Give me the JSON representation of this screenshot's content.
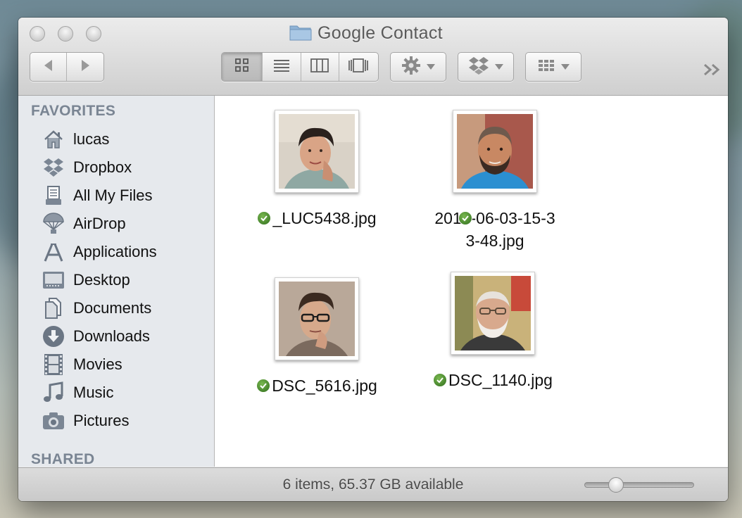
{
  "window": {
    "title": "Google Contact",
    "title_icon": "folder-icon"
  },
  "toolbar": {
    "back_icon": "chevron-left-icon",
    "forward_icon": "chevron-right-icon",
    "view_modes": [
      {
        "name": "icon-view",
        "icon": "grid-icon",
        "active": true
      },
      {
        "name": "list-view",
        "icon": "list-icon",
        "active": false
      },
      {
        "name": "column-view",
        "icon": "columns-icon",
        "active": false
      },
      {
        "name": "cover-flow-view",
        "icon": "coverflow-icon",
        "active": false
      }
    ],
    "action_icon": "gear-icon",
    "dropbox_icon": "dropbox-icon",
    "arrange_icon": "arrange-grid-icon",
    "overflow_icon": "double-chevron-right-icon"
  },
  "sidebar": {
    "favorites_heading": "FAVORITES",
    "items": [
      {
        "label": "lucas",
        "icon": "home-icon"
      },
      {
        "label": "Dropbox",
        "icon": "dropbox-icon"
      },
      {
        "label": "All My Files",
        "icon": "all-files-icon"
      },
      {
        "label": "AirDrop",
        "icon": "airdrop-icon"
      },
      {
        "label": "Applications",
        "icon": "applications-icon"
      },
      {
        "label": "Desktop",
        "icon": "desktop-icon"
      },
      {
        "label": "Documents",
        "icon": "documents-icon"
      },
      {
        "label": "Downloads",
        "icon": "downloads-icon"
      },
      {
        "label": "Movies",
        "icon": "movies-icon"
      },
      {
        "label": "Music",
        "icon": "music-icon"
      },
      {
        "label": "Pictures",
        "icon": "pictures-icon"
      }
    ],
    "shared_heading": "SHARED"
  },
  "files": [
    {
      "name": "_LUC5438.jpg",
      "synced": true
    },
    {
      "name": "2012-06-03-15-33-48.jpg",
      "name_lines": [
        "2012-06-03-15-3",
        "3-48.jpg"
      ],
      "synced": true
    },
    {
      "name": "DSC_5616.jpg",
      "synced": true
    },
    {
      "name": "DSC_1140.jpg",
      "synced": true
    }
  ],
  "status": {
    "text": "6 items, 65.37 GB available",
    "icon_size_level": 0.25
  },
  "colors": {
    "sidebar_bg": "#e6e9ed",
    "sidebar_heading": "#7a8593",
    "sync_check": "#3f8a2a"
  }
}
